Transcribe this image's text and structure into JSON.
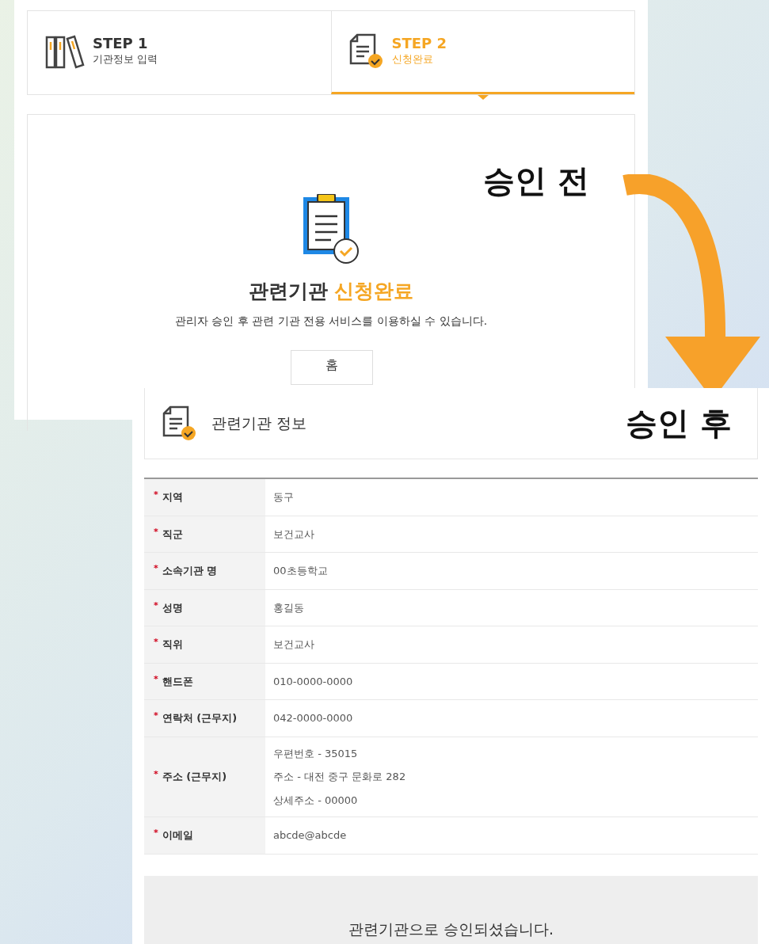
{
  "before": {
    "steps": [
      {
        "step": "STEP 1",
        "label": "기관정보 입력",
        "selected": false,
        "kind": "binders"
      },
      {
        "step": "STEP 2",
        "label": "신청완료",
        "selected": true,
        "kind": "document"
      }
    ],
    "title": "관련기관",
    "title_highlight": "신청완료",
    "message": "관리자 승인 후 관련 기관 전용 서비스를 이용하실 수 있습니다.",
    "home_button": "홈"
  },
  "captions": [
    "승인 전",
    "승인 후"
  ],
  "after": {
    "header": "관련기관 정보",
    "rows": [
      {
        "mark": "*",
        "label": "지역",
        "values": [
          "동구"
        ]
      },
      {
        "mark": "*",
        "label": "직군",
        "values": [
          "보건교사"
        ]
      },
      {
        "mark": "*",
        "label": "소속기관 명",
        "values": [
          "00초등학교"
        ]
      },
      {
        "mark": "*",
        "label": "성명",
        "values": [
          "홍길동"
        ]
      },
      {
        "mark": "*",
        "label": "직위",
        "values": [
          "보건교사"
        ]
      },
      {
        "mark": "*",
        "label": "핸드폰",
        "values": [
          "010-0000-0000"
        ]
      },
      {
        "mark": "*",
        "label": "연락처 (근무지)",
        "values": [
          "042-0000-0000"
        ]
      },
      {
        "mark": "*",
        "label": "주소 (근무지)",
        "values": [
          "우편번호 - 35015",
          "주소 - 대전 중구 문화로 282",
          "상세주소 - 00000"
        ]
      },
      {
        "mark": "*",
        "label": "이메일",
        "values": [
          "abcde@abcde"
        ]
      }
    ],
    "notice": "관련기관으로 승인되셨습니다."
  }
}
